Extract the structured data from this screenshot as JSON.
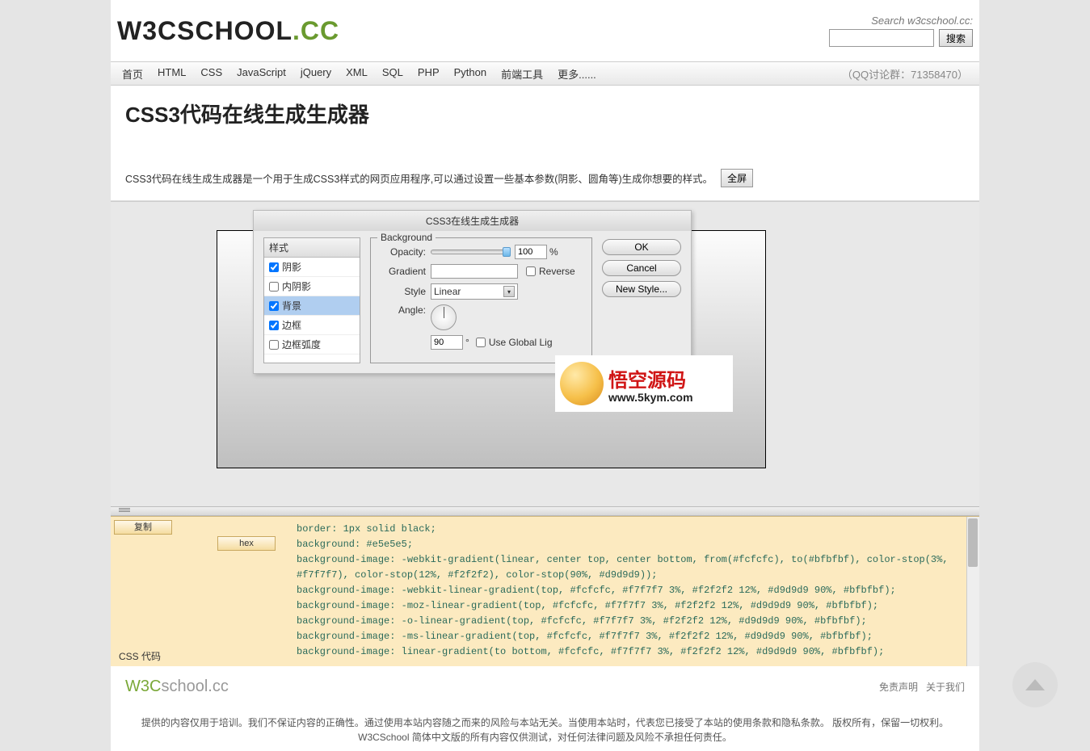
{
  "header": {
    "logo_part1": "W3CSCHOOL",
    "logo_part2": ".CC",
    "search_label": "Search w3cschool.cc:",
    "search_btn": "搜索"
  },
  "nav": {
    "items": [
      "首页",
      "HTML",
      "CSS",
      "JavaScript",
      "jQuery",
      "XML",
      "SQL",
      "PHP",
      "Python",
      "前端工具",
      "更多......"
    ],
    "qq": "（QQ讨论群：71358470）"
  },
  "page": {
    "title": "CSS3代码在线生成生成器",
    "desc": "CSS3代码在线生成生成器是一个用于生成CSS3样式的网页应用程序,可以通过设置一些基本参数(阴影、圆角等)生成你想要的样式。",
    "fullscreen": "全屏"
  },
  "tool": {
    "window_title": "CSS3在线生成生成器",
    "style_header": "样式",
    "styles": [
      {
        "label": "阴影",
        "checked": true,
        "selected": false
      },
      {
        "label": "内阴影",
        "checked": false,
        "selected": false
      },
      {
        "label": "背景",
        "checked": true,
        "selected": true
      },
      {
        "label": "边框",
        "checked": true,
        "selected": false
      },
      {
        "label": "边框弧度",
        "checked": false,
        "selected": false
      }
    ],
    "fieldset_legend": "Background",
    "opacity_label": "Opacity:",
    "opacity_value": "100",
    "opacity_unit": "%",
    "gradient_label": "Gradient",
    "reverse_label": "Reverse",
    "style_label": "Style",
    "style_value": "Linear",
    "angle_label": "Angle:",
    "angle_value": "90",
    "angle_unit": "°",
    "global_light": "Use Global Lig",
    "ok_btn": "OK",
    "cancel_btn": "Cancel",
    "newstyle_btn": "New Style..."
  },
  "watermark": {
    "text1": "悟空源码",
    "text2": "www.5kym.com"
  },
  "code": {
    "copy_btn": "复制",
    "hex_btn": "hex",
    "css_label": "CSS 代码",
    "lines": [
      "border: 1px solid black;",
      "background: #e5e5e5;",
      "background-image: -webkit-gradient(linear, center top, center bottom, from(#fcfcfc), to(#bfbfbf), color-stop(3%, #f7f7f7), color-stop(12%, #f2f2f2), color-stop(90%, #d9d9d9));",
      "background-image: -webkit-linear-gradient(top, #fcfcfc, #f7f7f7 3%, #f2f2f2 12%, #d9d9d9 90%, #bfbfbf);",
      "background-image: -moz-linear-gradient(top, #fcfcfc, #f7f7f7 3%, #f2f2f2 12%, #d9d9d9 90%, #bfbfbf);",
      "background-image: -o-linear-gradient(top, #fcfcfc, #f7f7f7 3%, #f2f2f2 12%, #d9d9d9 90%, #bfbfbf);",
      "background-image: -ms-linear-gradient(top, #fcfcfc, #f7f7f7 3%, #f2f2f2 12%, #d9d9d9 90%, #bfbfbf);",
      "background-image: linear-gradient(to bottom, #fcfcfc, #f7f7f7 3%, #f2f2f2 12%, #d9d9d9 90%, #bfbfbf);"
    ]
  },
  "footer": {
    "logo1": "W3C",
    "logo2": "school.cc",
    "links": [
      "免责声明",
      "关于我们"
    ],
    "line1": "提供的内容仅用于培训。我们不保证内容的正确性。通过使用本站内容随之而来的风险与本站无关。当使用本站时，代表您已接受了本站的使用条款和隐私条款。 版权所有，保留一切权利。",
    "line2": "W3CSchool 简体中文版的所有内容仅供测试，对任何法律问题及风险不承担任何责任。"
  }
}
